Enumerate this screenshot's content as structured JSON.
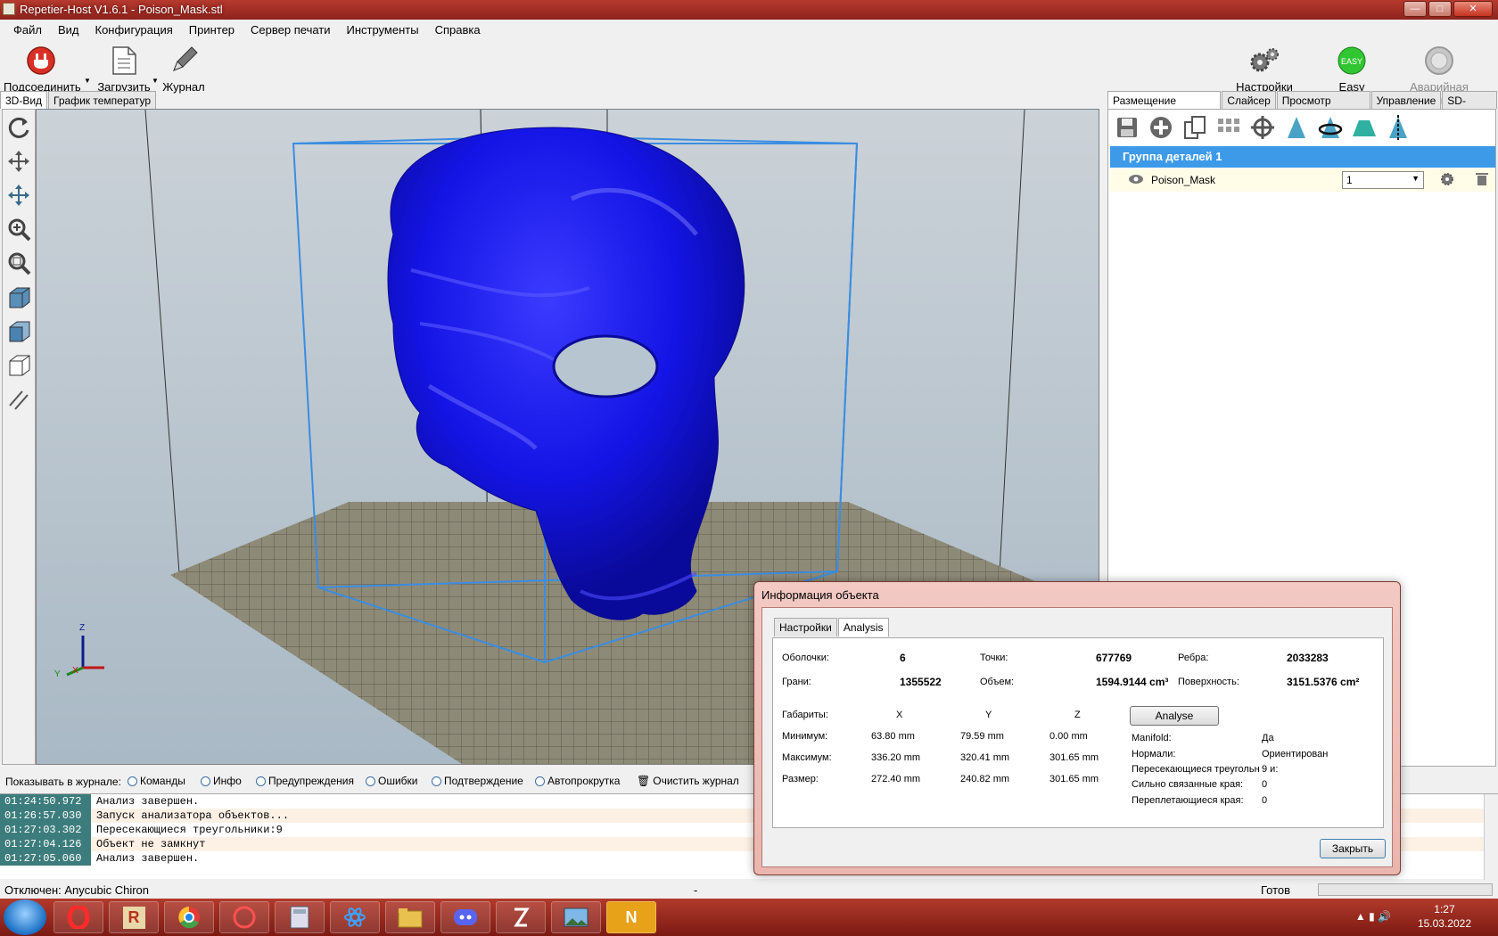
{
  "window": {
    "title": "Repetier-Host V1.6.1 - Poison_Mask.stl",
    "controls": [
      "—",
      "□",
      "✕"
    ]
  },
  "menu": [
    "Файл",
    "Вид",
    "Конфигурация",
    "Принтер",
    "Сервер печати",
    "Инструменты",
    "Справка"
  ],
  "toolbar": {
    "connect": "Подсоединить",
    "load": "Загрузить",
    "log": "Журнал",
    "printer_settings": "Настройки принтера",
    "easy_mode": "Easy Mode",
    "easy_badge": "EASY",
    "emergency_stop": "Аварийная остановка"
  },
  "left_tabs": [
    "3D-Вид",
    "График температур"
  ],
  "right_tabs": [
    "Размещение объекта",
    "Слайсер",
    "Просмотр печати",
    "Управление",
    "SD-карта"
  ],
  "object_panel": {
    "group_label": "Группа деталей 1",
    "object_name": "Poison_Mask",
    "extruder_value": "1"
  },
  "axes": {
    "x": "X",
    "y": "Y",
    "z": "Z"
  },
  "log": {
    "filter_label": "Показывать в журнале:",
    "filters": [
      "Команды",
      "Инфо",
      "Предупреждения",
      "Ошибки",
      "Подтверждение",
      "Автопрокрутка"
    ],
    "clear_label": "Очистить журнал",
    "entries": [
      {
        "time": "01:24:50.972",
        "text": "Анализ завершен."
      },
      {
        "time": "01:26:57.030",
        "text": "Запуск анализатора объектов..."
      },
      {
        "time": "01:27:03.302",
        "text": "Пересекающиеся треугольники:9"
      },
      {
        "time": "01:27:04.126",
        "text": "Объект не замкнут"
      },
      {
        "time": "01:27:05.060",
        "text": "Анализ завершен."
      }
    ]
  },
  "status": {
    "connection": "Отключен: Anycubic Chiron",
    "middle": "-",
    "ready": "Готов"
  },
  "dialog": {
    "title": "Информация объекта",
    "tabs": [
      "Настройки",
      "Analysis"
    ],
    "shells_label": "Оболочки:",
    "shells": "6",
    "points_label": "Точки:",
    "points": "677769",
    "edges_label": "Ребра:",
    "edges": "2033283",
    "faces_label": "Грани:",
    "faces": "1355522",
    "volume_label": "Объем:",
    "volume": "1594.9144 cm³",
    "surface_label": "Поверхность:",
    "surface": "3151.5376 cm²",
    "dims_label": "Габариты:",
    "col_x": "X",
    "col_y": "Y",
    "col_z": "Z",
    "min_label": "Минимум:",
    "min_x": "63.80 mm",
    "min_y": "79.59 mm",
    "min_z": "0.00 mm",
    "max_label": "Максимум:",
    "max_x": "336.20 mm",
    "max_y": "320.41 mm",
    "max_z": "301.65 mm",
    "size_label": "Размер:",
    "size_x": "272.40 mm",
    "size_y": "240.82 mm",
    "size_z": "301.65 mm",
    "analyse_button": "Analyse",
    "manifold_label": "Manifold:",
    "manifold": "Да",
    "normals_label": "Нормали:",
    "normals": "Ориентирован",
    "intersect_label": "Пересекающиеся треугольн",
    "intersect": "9 и:",
    "highly_label": "Сильно связанные края:",
    "highly": "0",
    "loose_label": "Переплетающиеся края:",
    "loose": "0",
    "close_button": "Закрыть"
  },
  "taskbar": {
    "app_letter_r": "R",
    "app_letter_n": "N",
    "time": "1:27",
    "date": "15.03.2022"
  },
  "colors": {
    "model": "#1414e6",
    "bbox": "#3b8de0",
    "selection": "#3d9ae8"
  }
}
